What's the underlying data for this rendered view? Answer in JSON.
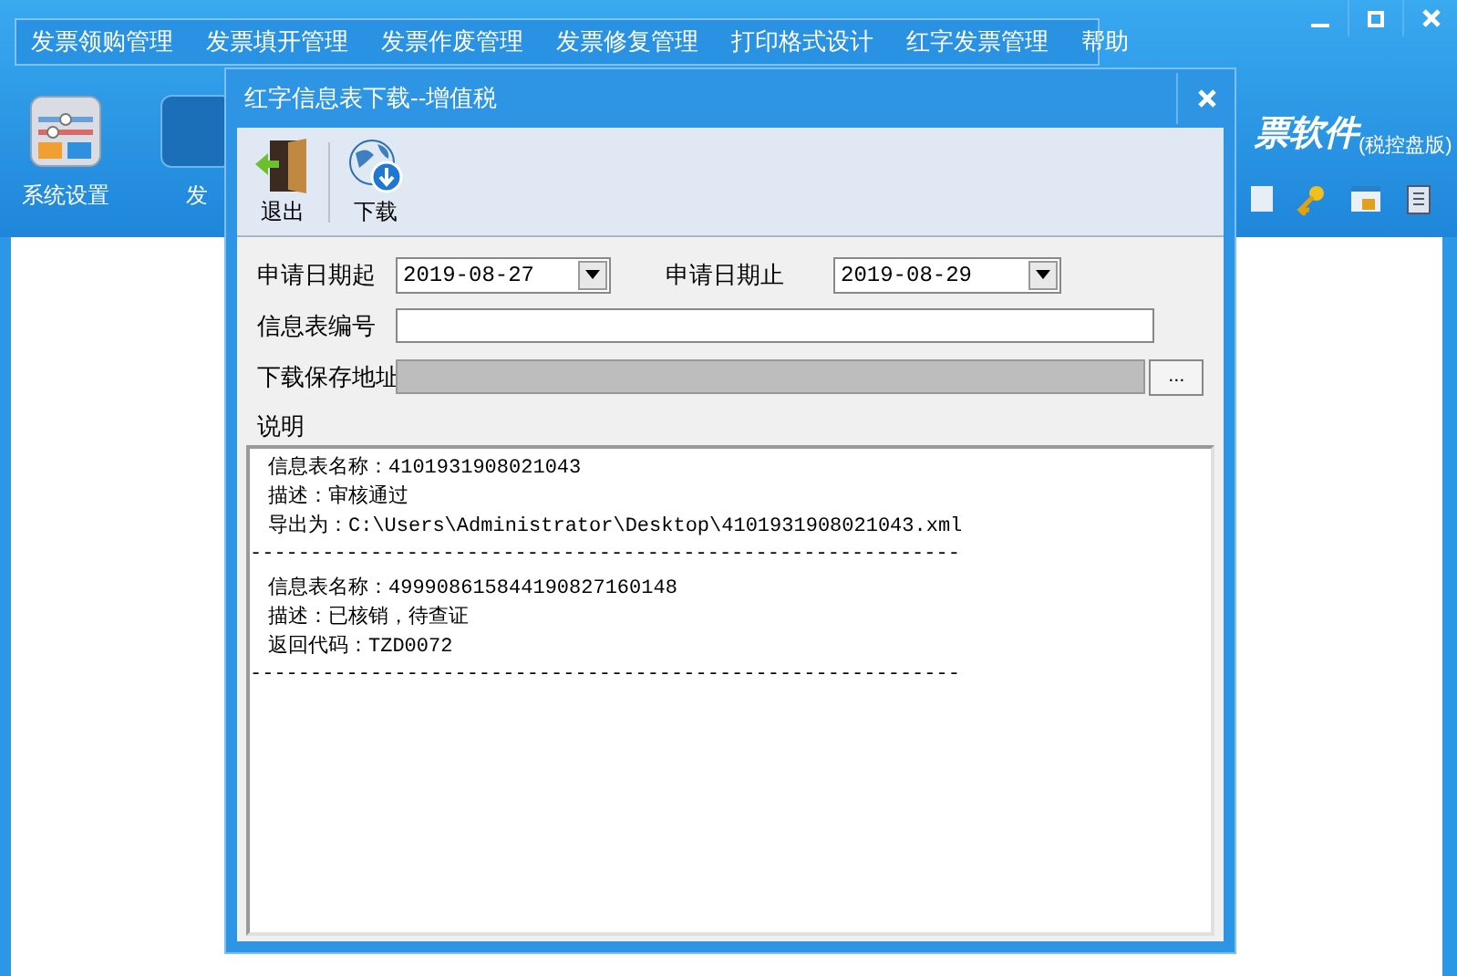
{
  "menu": {
    "items": [
      "发票领购管理",
      "发票填开管理",
      "发票作废管理",
      "发票修复管理",
      "打印格式设计",
      "红字发票管理",
      "帮助"
    ]
  },
  "app_toolbar": {
    "items": [
      {
        "label": "系统设置",
        "kind": "settings"
      },
      {
        "label": "发",
        "kind": "partial"
      }
    ],
    "brand": "票软件",
    "edition": "(税控盘版)"
  },
  "dialog": {
    "title": "红字信息表下载--增值税",
    "toolbar": [
      {
        "label": "退出",
        "kind": "exit"
      },
      {
        "label": "下载",
        "kind": "download"
      }
    ],
    "start_date": {
      "label": "申请日期起",
      "value": "2019-08-27"
    },
    "end_date": {
      "label": "申请日期止",
      "value": "2019-08-29"
    },
    "info_number": {
      "label": "信息表编号"
    },
    "save_path": {
      "label": "下载保存地址",
      "browse": "..."
    },
    "notes": {
      "label": "说明",
      "entries": [
        {
          "lines": [
            "信息表名称：4101931908021043",
            "描述：审核通过",
            "导出为：C:\\Users\\Administrator\\Desktop\\4101931908021043.xml"
          ],
          "separator": "-----------------------------------------------------------"
        },
        {
          "lines": [
            "信息表名称：49990861584419082716014​8",
            "描述：已核销，待查证",
            "返回代码：TZD0072"
          ],
          "separator": "-----------------------------------------------------------"
        }
      ]
    }
  }
}
